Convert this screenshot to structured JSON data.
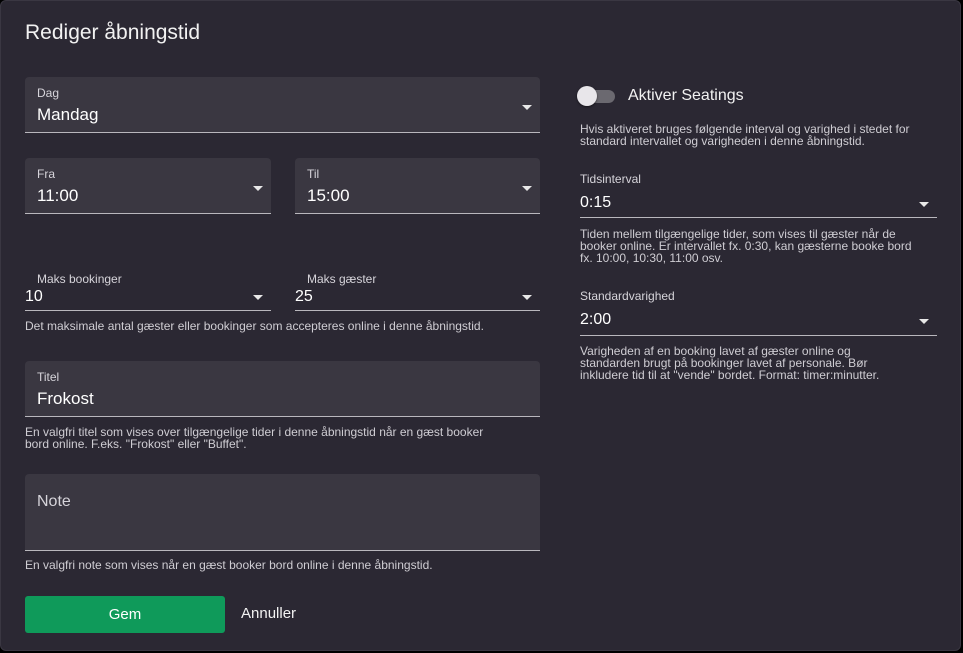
{
  "dialog": {
    "title": "Rediger åbningstid",
    "day": {
      "label": "Dag",
      "value": "Mandag"
    },
    "from": {
      "label": "Fra",
      "value": "11:00"
    },
    "to": {
      "label": "Til",
      "value": "15:00"
    },
    "max_bookings": {
      "label": "Maks bookinger",
      "value": "10"
    },
    "max_guests": {
      "label": "Maks gæster",
      "value": "25"
    },
    "max_hint": "Det maksimale antal gæster eller bookinger som accepteres online i denne åbningstid.",
    "title_field": {
      "label": "Titel",
      "value": "Frokost",
      "hint_line1": "En valgfri titel som vises over tilgængelige tider i denne åbningstid når en gæst booker",
      "hint_line2": "bord online. F.eks. \"Frokost\" eller \"Buffet\"."
    },
    "note_field": {
      "placeholder": "Note",
      "hint": "En valgfri note som vises når en gæst booker bord online i denne åbningstid."
    },
    "seatings": {
      "toggle_label": "Aktiver Seatings",
      "toggle_on": false,
      "hint_line1": "Hvis aktiveret bruges følgende interval og varighed i stedet for",
      "hint_line2": "standard intervallet og varigheden i denne åbningstid."
    },
    "time_interval": {
      "label": "Tidsinterval",
      "value": "0:15",
      "hint_line1": "Tiden mellem tilgængelige tider, som vises til gæster når de",
      "hint_line2": "booker online. Er intervallet fx. 0:30, kan gæsterne booke bord",
      "hint_line3": "fx. 10:00, 10:30, 11:00 osv."
    },
    "standard_duration": {
      "label": "Standardvarighed",
      "value": "2:00",
      "hint_line1": "Varigheden af en booking lavet af gæster online og",
      "hint_line2": "standarden brugt på bookinger lavet af personale. Bør",
      "hint_line3": "inkludere tid til at \"vende\" bordet. Format: timer:minutter."
    },
    "buttons": {
      "save": "Gem",
      "cancel": "Annuller"
    },
    "colors": {
      "accent": "#0f9a5a",
      "background": "#2b2833",
      "field": "#3a3741"
    }
  }
}
